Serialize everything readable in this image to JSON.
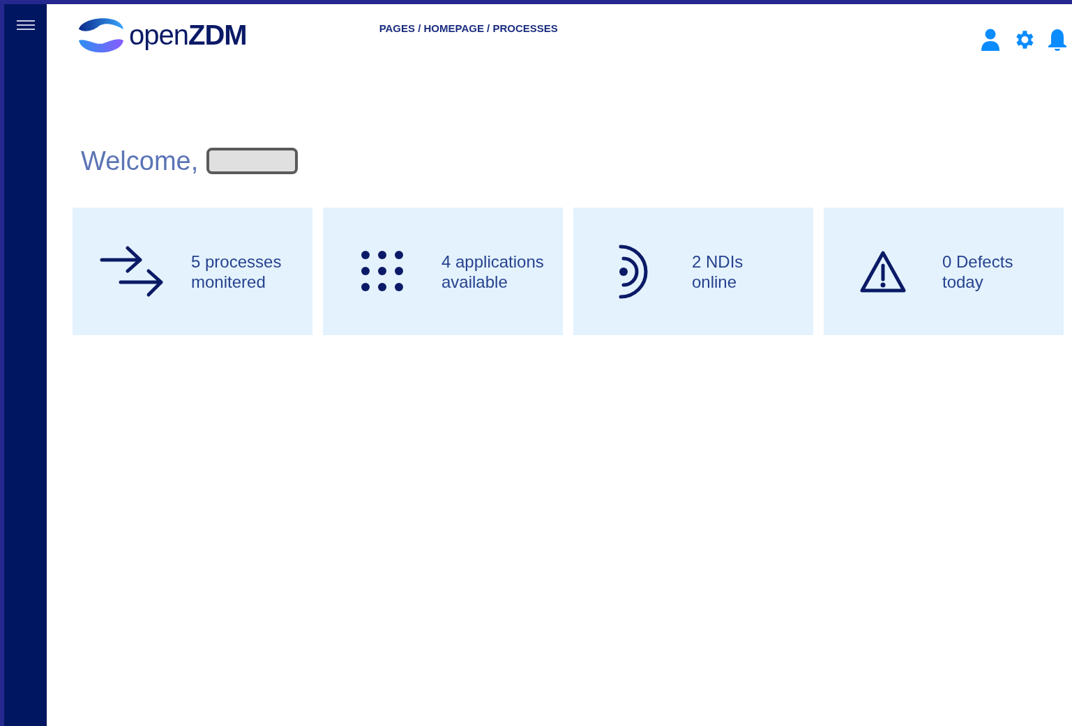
{
  "logo": {
    "text_light": "open",
    "text_bold": "ZDM"
  },
  "breadcrumb": "PAGES / HOMEPAGE / PROCESSES",
  "greeting": {
    "text": "Welcome,"
  },
  "cards": [
    {
      "kind": "processes",
      "lines": [
        "5 processes",
        "monitered"
      ]
    },
    {
      "kind": "applications",
      "lines": [
        "4 applications",
        "available"
      ]
    },
    {
      "kind": "ndis",
      "lines": [
        "2 NDIs",
        "online"
      ]
    },
    {
      "kind": "defects",
      "lines": [
        "0 Defects",
        "today"
      ]
    }
  ]
}
